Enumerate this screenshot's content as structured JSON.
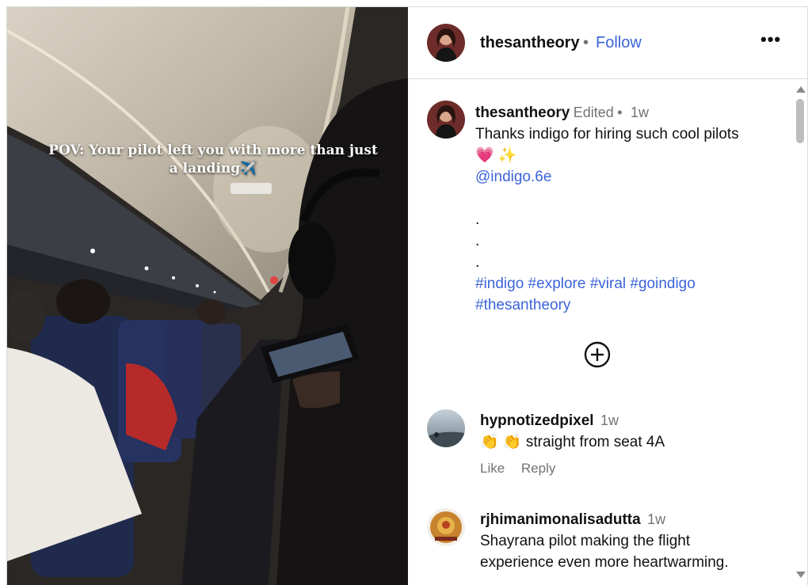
{
  "media": {
    "overlay_text": "POV: Your pilot left you with more than just a landing✈️"
  },
  "header": {
    "username": "thesantheory",
    "separator": "•",
    "follow_label": "Follow",
    "more_label": "•••"
  },
  "caption": {
    "username": "thesantheory",
    "edited": "Edited",
    "separator": "•",
    "time": "1w",
    "line1": "Thanks indigo for hiring such cool pilots",
    "emojis": "💗 ✨",
    "mention": "@indigo.6e",
    "dots": [
      ".",
      ".",
      "."
    ],
    "hashtags_line1": "#indigo #explore #viral #goindigo",
    "hashtags_line2": "#thesantheory"
  },
  "comments": [
    {
      "username": "hypnotizedpixel",
      "time": "1w",
      "emojis": "👏 👏",
      "text": "straight from seat 4A",
      "like_label": "Like",
      "reply_label": "Reply"
    },
    {
      "username": "rjhimanimonalisadutta",
      "time": "1w",
      "text_line1": "Shayrana pilot making the flight",
      "text_line2": "experience even more heartwarming."
    }
  ],
  "colors": {
    "link": "#3b64d8",
    "meta": "#737373",
    "border": "#dbdbdb"
  }
}
